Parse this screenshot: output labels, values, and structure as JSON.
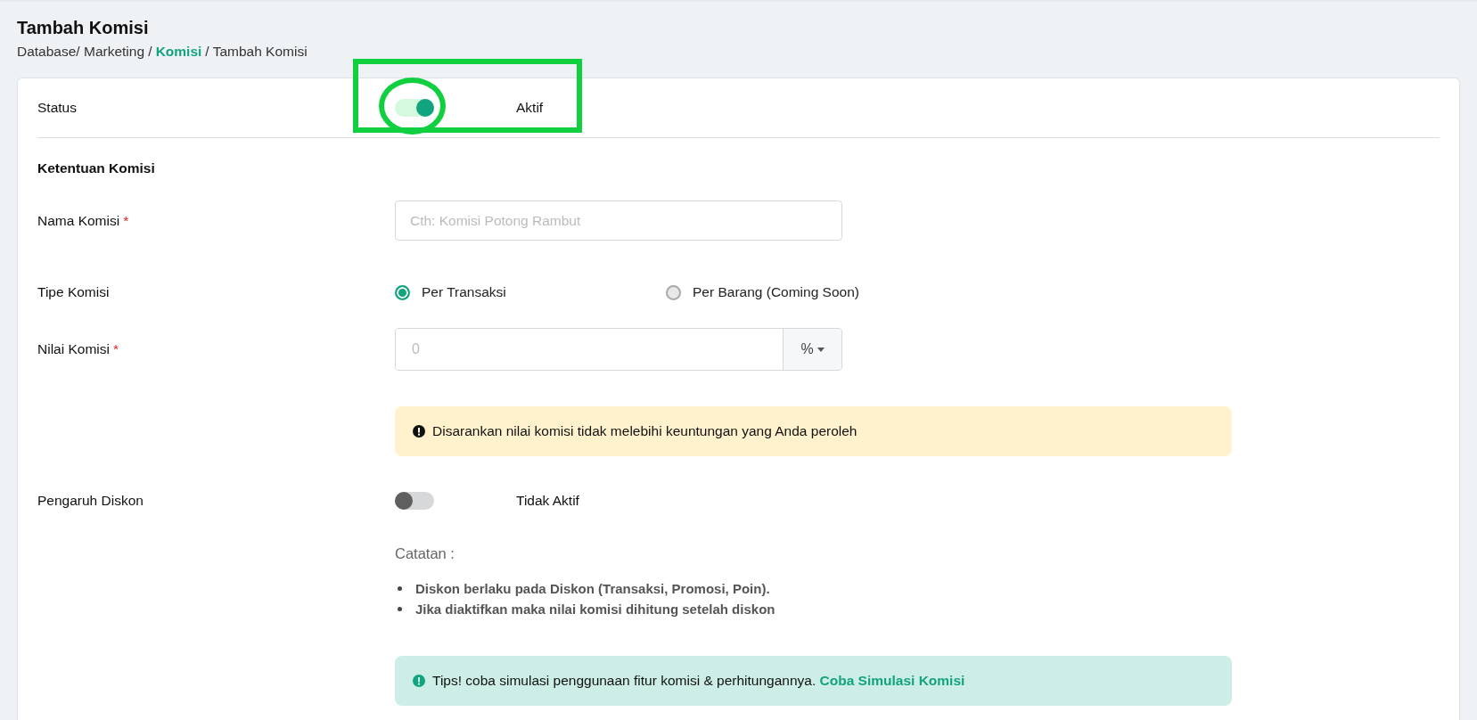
{
  "page": {
    "title": "Tambah Komisi",
    "breadcrumb": [
      {
        "label": "Database/ Marketing /",
        "kind": "text"
      },
      {
        "label": "Komisi",
        "kind": "link"
      },
      {
        "label": "/ Tambah Komisi",
        "kind": "text"
      }
    ]
  },
  "status": {
    "label": "Status",
    "on": true,
    "state_label": "Aktif",
    "annotation": {
      "kind": "highlight"
    }
  },
  "section_title": "Ketentuan Komisi",
  "nama_komisi": {
    "label": "Nama Komisi",
    "required_mark": "*",
    "placeholder": "Cth: Komisi Potong Rambut"
  },
  "tipe_komisi": {
    "label": "Tipe Komisi",
    "options": [
      {
        "label": "Per Transaksi",
        "selected": true
      },
      {
        "label": "Per Barang (Coming Soon)",
        "selected": false
      }
    ]
  },
  "nilai_komisi": {
    "label": "Nilai Komisi",
    "required_mark": "*",
    "placeholder": "0",
    "unit": "%"
  },
  "warning": {
    "kind": "warning",
    "text": "Disarankan nilai komisi tidak melebihi keuntungan yang Anda peroleh"
  },
  "pengaruh_diskon": {
    "label": "Pengaruh Diskon",
    "on": false,
    "state_label": "Tidak Aktif"
  },
  "catatan": {
    "title": "Catatan :",
    "items": [
      "Diskon berlaku pada Diskon (Transaksi, Promosi, Poin).",
      "Jika diaktifkan maka nilai komisi dihitung setelah diskon"
    ]
  },
  "tips": {
    "kind": "info",
    "text": "Tips! coba simulasi penggunaan fitur komisi & perhitungannya.",
    "link": "Coba Simulasi Komisi"
  }
}
